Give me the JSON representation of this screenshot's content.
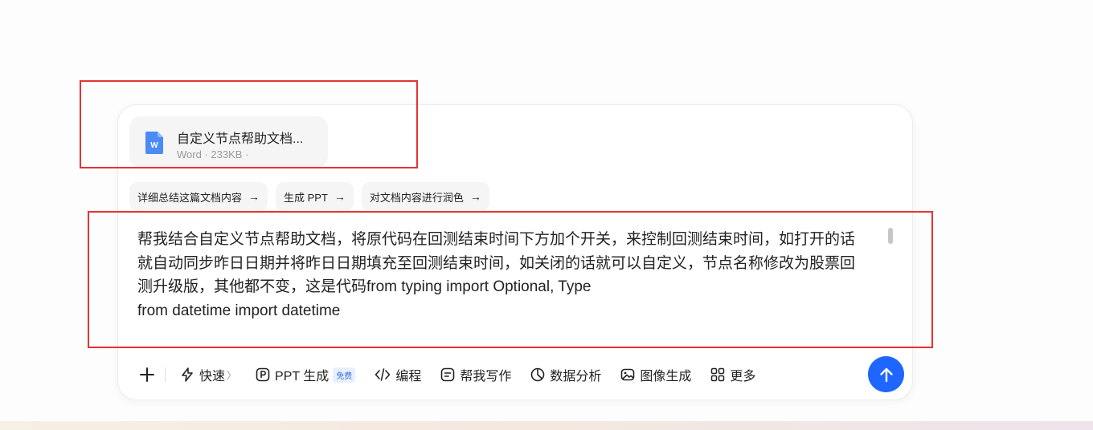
{
  "attachment": {
    "name": "自定义节点帮助文档...",
    "meta": "Word · 233KB ·",
    "icon": "word-file-icon",
    "icon_letter": "W",
    "icon_color": "#4a8bf5"
  },
  "suggestions": [
    {
      "label": "详细总结这篇文档内容",
      "arrow": "→"
    },
    {
      "label": "生成 PPT",
      "arrow": "→"
    },
    {
      "label": "对文档内容进行润色",
      "arrow": "→"
    }
  ],
  "prompt": {
    "lines": [
      "帮我结合自定义节点帮助文档，将原代码在回测结束时间下方加个开关，来控制回测结束时间，如打开的话",
      "就自动同步昨日日期并将昨日日期填充至回测结束时间，如关闭的话就可以自定义，节点名称修改为股票回",
      "测升级版，其他都不变，这是代码from typing import Optional, Type",
      "from datetime import datetime"
    ]
  },
  "toolbar": {
    "quick": "快速",
    "quick_chevron": "〉",
    "ppt": "PPT 生成",
    "ppt_badge": "免费",
    "code": "编程",
    "write": "帮我写作",
    "data": "数据分析",
    "image": "图像生成",
    "more": "更多"
  },
  "colors": {
    "send_button": "#1f66ff",
    "annotation_red": "#e53333"
  }
}
